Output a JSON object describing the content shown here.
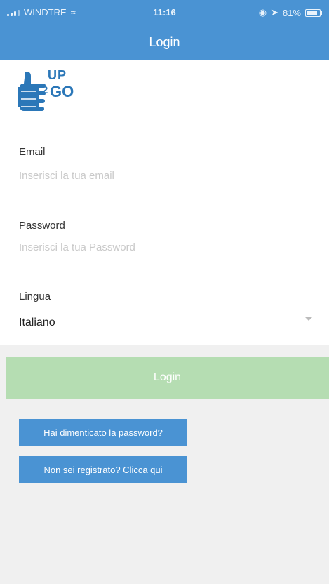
{
  "status_bar": {
    "carrier": "WINDTRE",
    "time": "11:16",
    "battery": "81%",
    "battery_level": 0.81
  },
  "header": {
    "title": "Login"
  },
  "logo": {
    "up": "UP",
    "two": "2",
    "go": "GO"
  },
  "form": {
    "email_label": "Email",
    "email_placeholder": "Inserisci la tua email",
    "password_label": "Password",
    "password_placeholder": "Inserisci la tua Password",
    "language_label": "Lingua",
    "language_value": "Italiano"
  },
  "actions": {
    "login": "Login",
    "forgot_password": "Hai dimenticato la password?",
    "register": "Non sei registrato? Clicca qui"
  },
  "colors": {
    "header": "#4a93d3",
    "login_button": "#b5ddb2",
    "link_buttons": "#4a93d3",
    "background": "#f0f0f0"
  }
}
